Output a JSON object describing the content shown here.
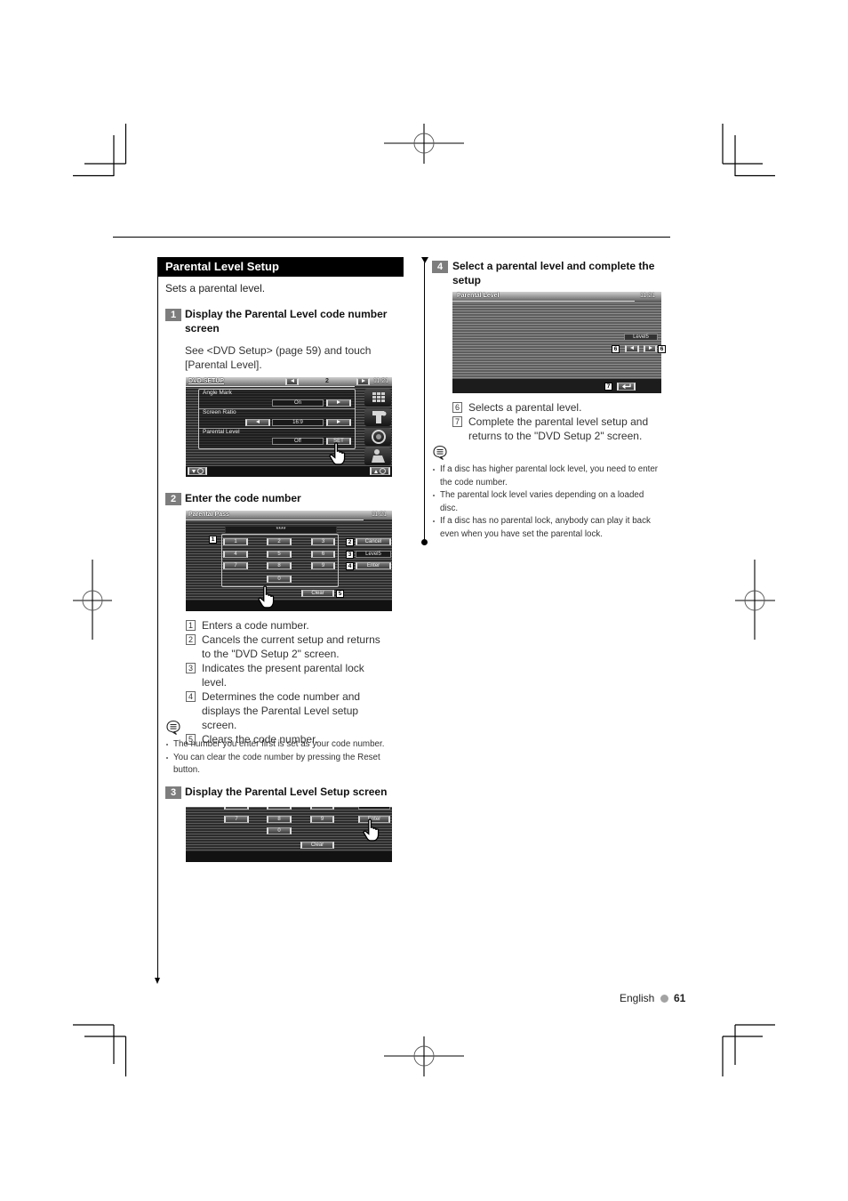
{
  "footer": {
    "language": "English",
    "page_number": "61"
  },
  "section": {
    "title": "Parental Level Setup",
    "intro": "Sets a parental level."
  },
  "steps": {
    "s1": {
      "number": "1",
      "title": "Display the Parental Level code number screen",
      "body": "See <DVD Setup> (page 59) and touch [Parental Level]."
    },
    "s2": {
      "number": "2",
      "title": "Enter the code number",
      "callouts": [
        {
          "num": "1",
          "text": "Enters a code number."
        },
        {
          "num": "2",
          "text": "Cancels the current setup and returns to the \"DVD Setup 2\" screen."
        },
        {
          "num": "3",
          "text": "Indicates the present parental lock level."
        },
        {
          "num": "4",
          "text": "Determines the code number and displays the Parental Level setup screen."
        },
        {
          "num": "5",
          "text": "Clears the code number."
        }
      ],
      "notes": [
        "The number you enter first is set as your code number.",
        "You can clear the code number by pressing the Reset button."
      ]
    },
    "s3": {
      "number": "3",
      "title": "Display the Parental Level Setup screen"
    },
    "s4": {
      "number": "4",
      "title": "Select a parental level and complete the setup",
      "callouts": [
        {
          "num": "6",
          "text": "Selects a parental level."
        },
        {
          "num": "7",
          "text": "Complete the parental level setup and returns to the \"DVD Setup 2\" screen."
        }
      ],
      "notes": [
        "If a disc has higher parental lock level, you need to enter the code number.",
        "The parental lock level varies depending on a loaded disc.",
        "If a disc has no parental lock, anybody can play it back even when you have set the parental lock."
      ]
    }
  },
  "screens": {
    "dvd_setup": {
      "title": "DVD SETUP",
      "page": "2",
      "time": "11:21",
      "rows": [
        {
          "label": "Angle Mark",
          "value": "On"
        },
        {
          "label": "Screen Ratio",
          "value": "16:9"
        },
        {
          "label": "Parental Level",
          "value": "Off",
          "button": "SET"
        }
      ]
    },
    "parental_pass": {
      "title": "Parental Pass",
      "time": "11:21",
      "code": "****",
      "keys": [
        "1",
        "2",
        "3",
        "4",
        "5",
        "6",
        "7",
        "8",
        "9",
        "0"
      ],
      "cancel": "Cancel",
      "level": "Level5",
      "enter": "Enter",
      "clear": "Clear",
      "callouts": [
        "1",
        "2",
        "3",
        "4",
        "5"
      ]
    },
    "parental_pass_crop": {
      "keys": [
        "7",
        "8",
        "9",
        "0"
      ],
      "enter": "Enter",
      "clear": "Clear"
    },
    "parental_level": {
      "title": "Parental Level",
      "time": "11:21",
      "level": "Level5",
      "callouts": [
        "6",
        "6",
        "7"
      ]
    }
  }
}
